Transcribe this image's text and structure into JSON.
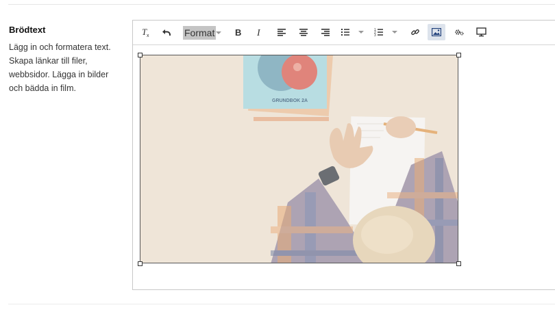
{
  "field": {
    "title": "Brödtext",
    "help_lines": [
      "Lägg in och formatera text.",
      "Skapa länkar till filer,",
      "webbsidor. Lägga in bilder",
      "och bädda in film."
    ]
  },
  "toolbar": {
    "format_label": "Format",
    "book_label": "GRUNDBOK 2A",
    "icons": [
      "remove-format-icon",
      "undo-icon",
      "bold-icon",
      "italic-icon",
      "align-left-icon",
      "align-center-icon",
      "align-right-icon",
      "bulleted-list-icon",
      "numbered-list-icon",
      "link-icon",
      "image-icon",
      "embed-icon",
      "preview-icon"
    ]
  },
  "colors": {
    "active_button": "#dde3ec",
    "format_bg": "#c4c4c4",
    "border": "#c8c8c8"
  }
}
